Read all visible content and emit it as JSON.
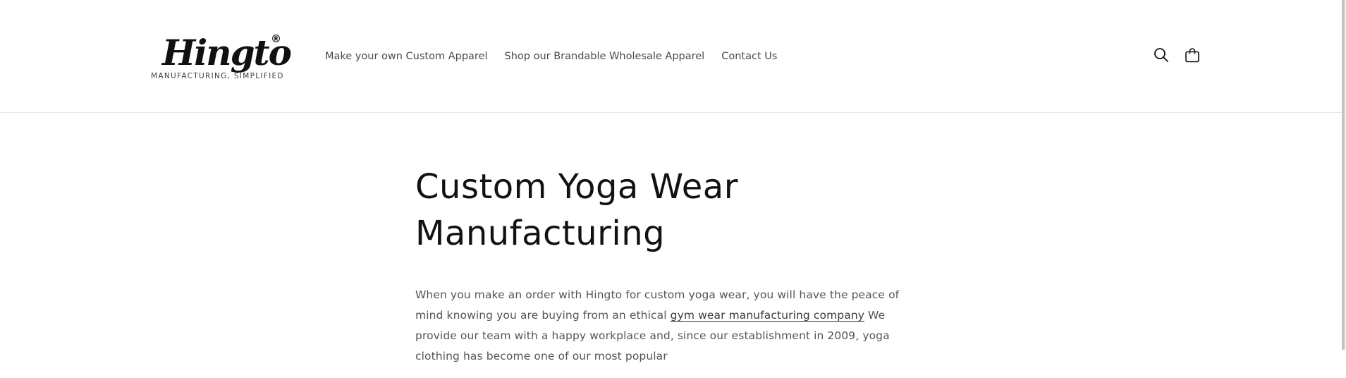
{
  "header": {
    "logo": {
      "word": "Hingto",
      "registered": "®",
      "tagline": "MANUFACTURING, SIMPLIFIED"
    },
    "nav": [
      {
        "label": "Make your own Custom Apparel"
      },
      {
        "label": "Shop our Brandable Wholesale Apparel"
      },
      {
        "label": "Contact Us"
      }
    ],
    "icons": {
      "search": "search-icon",
      "cart": "cart-icon"
    }
  },
  "main": {
    "title": "Custom Yoga Wear Manufacturing",
    "paragraph": {
      "before_link": "When you make an order with Hingto for custom yoga wear, you will have the peace of mind knowing you are buying from an ethical ",
      "link_text": "gym wear manufacturing company",
      "after_link": " We provide our team with a happy workplace and, since our establishment in 2009, yoga clothing has become one of our most popular"
    }
  },
  "colors": {
    "text": "#121212",
    "body_text": "#555555",
    "border": "#e6e6e6",
    "background": "#ffffff"
  }
}
